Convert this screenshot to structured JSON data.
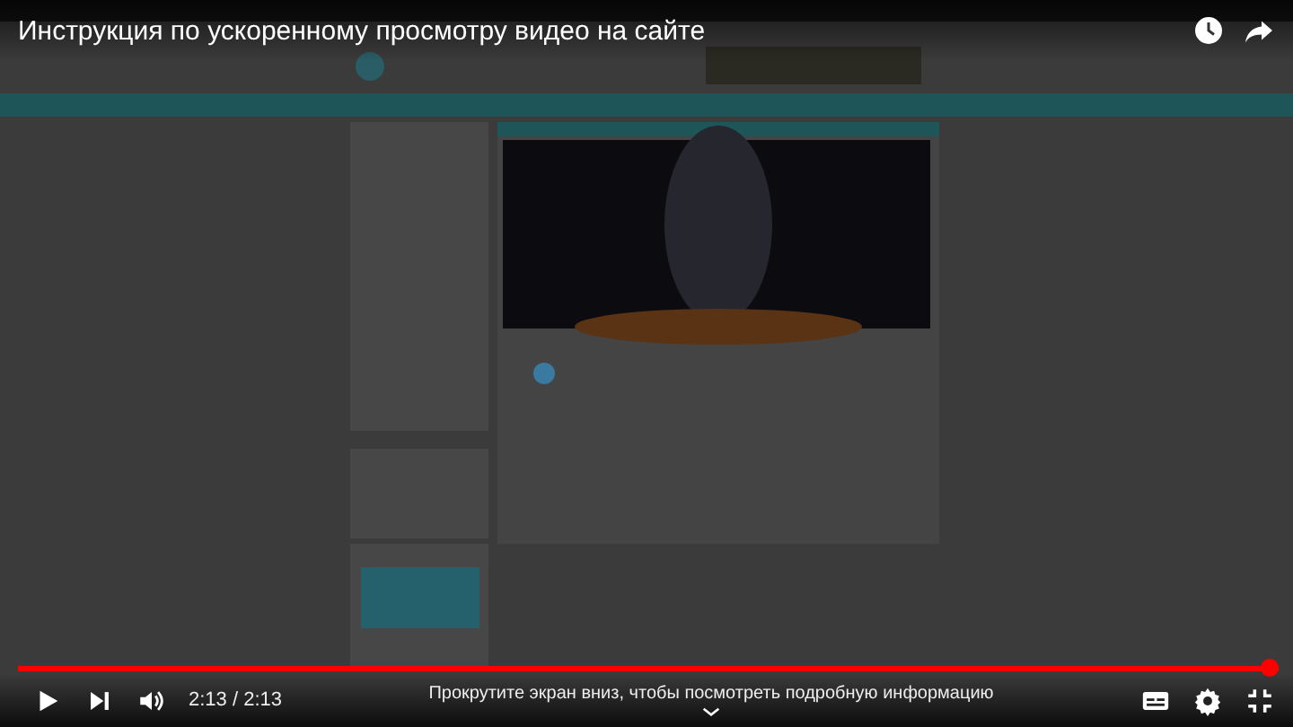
{
  "video": {
    "kind": "picture",
    "title": "Инструкция по ускоренному просмотру видео на сайте"
  },
  "progress": {
    "level": 1.0
  },
  "time": "2:13 / 2:13",
  "hint": "Прокрутите экран вниз, чтобы посмотреть подробную информацию"
}
